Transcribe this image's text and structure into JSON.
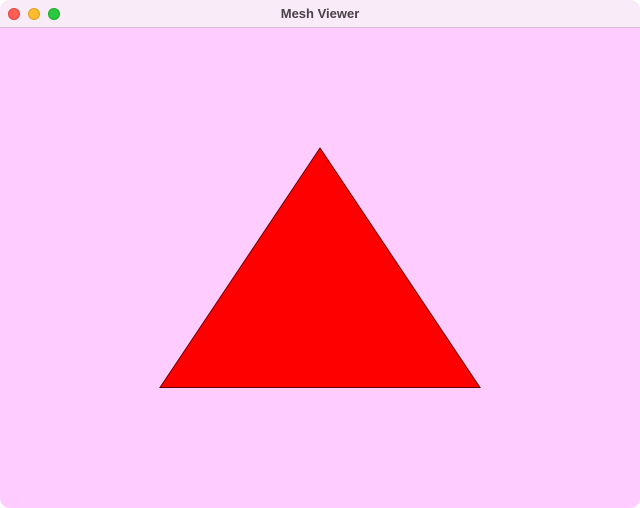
{
  "window": {
    "title": "Mesh Viewer",
    "background_color": "#ffccff",
    "titlebar_color": "#f9ecf8"
  },
  "controls": {
    "close": {
      "icon": "close-icon",
      "color": "#ff5f57",
      "border": "#e0443e"
    },
    "minimize": {
      "icon": "minimize-icon",
      "color": "#febc2e",
      "border": "#dea123"
    },
    "zoom": {
      "icon": "zoom-icon",
      "color": "#28c840",
      "border": "#1aab29"
    }
  },
  "viewport": {
    "mesh": {
      "shape": "triangle",
      "fill_color": "#ff0000",
      "edge_color": "#6a0000"
    }
  }
}
